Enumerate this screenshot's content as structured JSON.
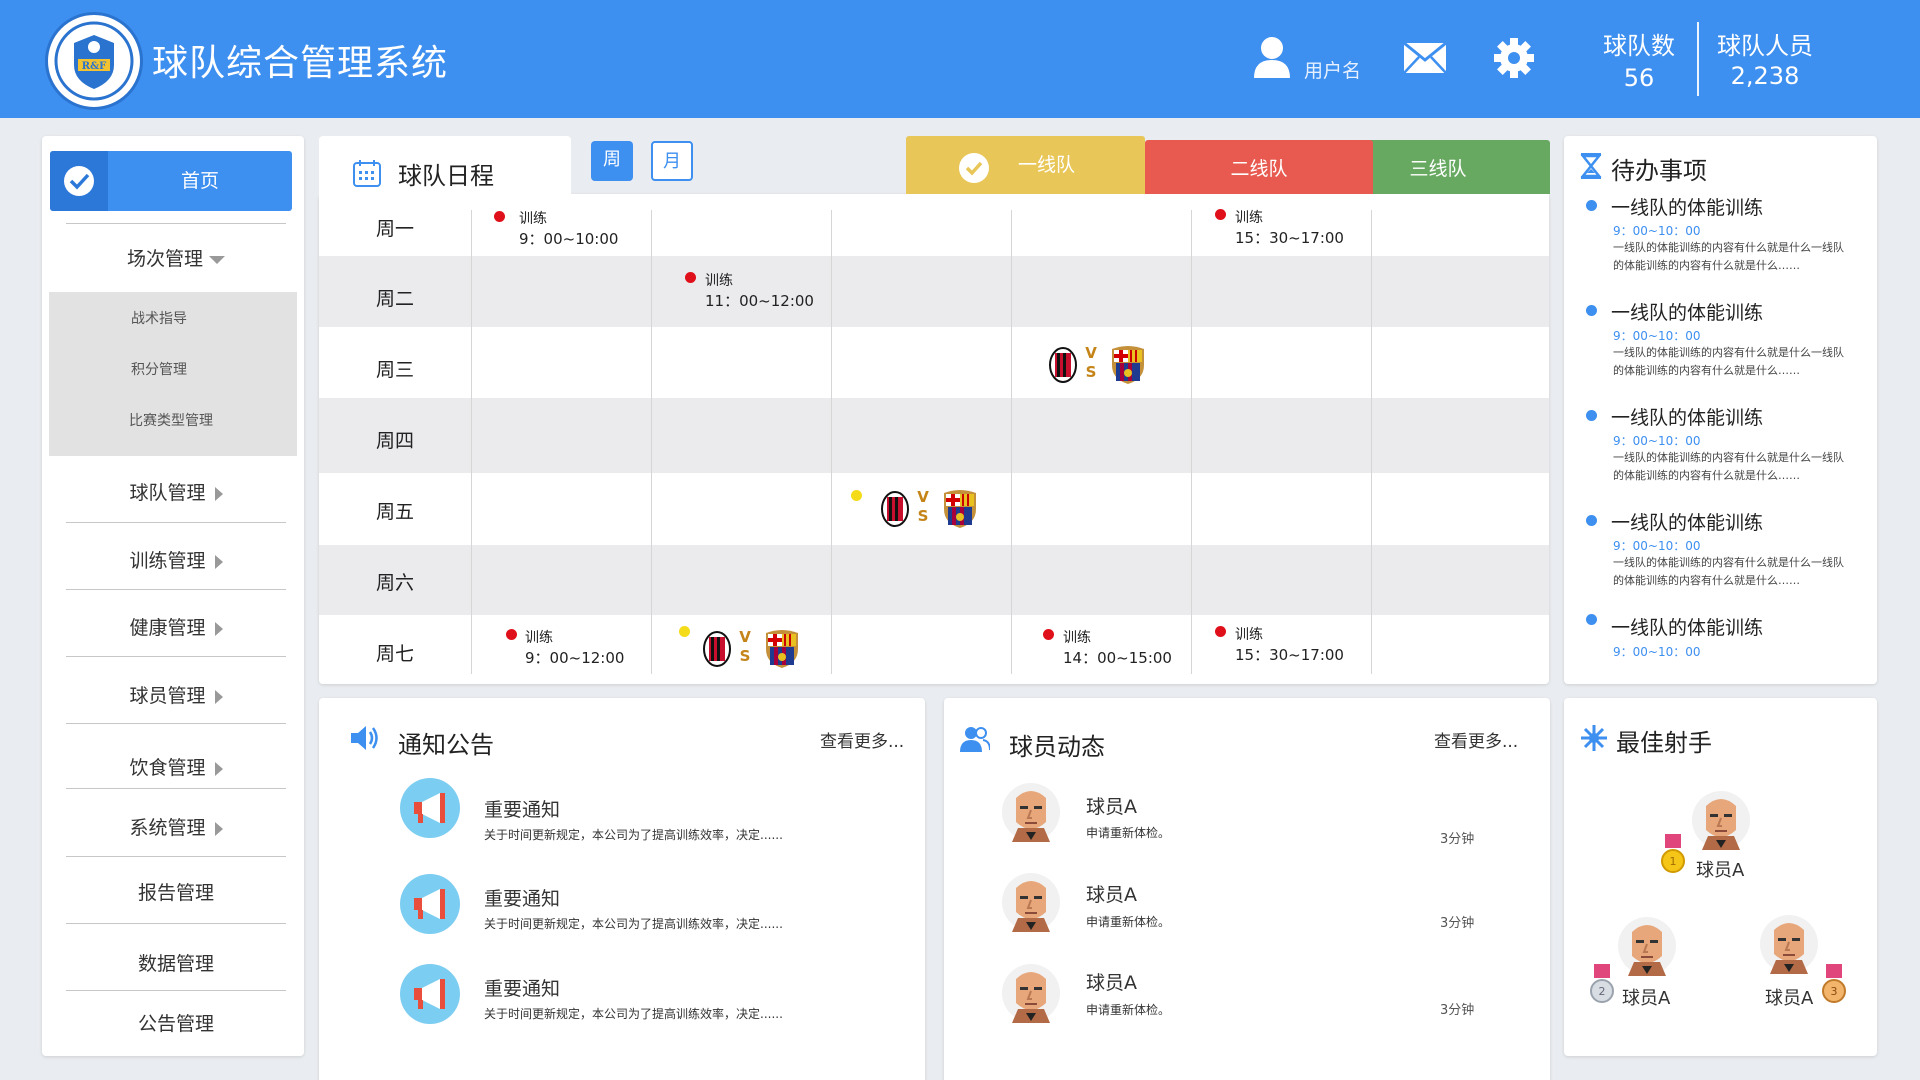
{
  "header": {
    "title": "球队综合管理系统",
    "logo_text": "R&F",
    "username": "用户名",
    "stats": [
      {
        "label": "球队数",
        "value": "56"
      },
      {
        "label": "球队人员",
        "value": "2,238"
      }
    ]
  },
  "sidebar": {
    "home": "首页",
    "match_mgmt": "场次管理",
    "sub_items": [
      "战术指导",
      "积分管理",
      "比赛类型管理"
    ],
    "items": [
      "球队管理",
      "训练管理",
      "健康管理",
      "球员管理",
      "饮食管理",
      "系统管理",
      "报告管理",
      "数据管理",
      "公告管理"
    ]
  },
  "schedule": {
    "title": "球队日程",
    "view_week": "周",
    "view_month": "月",
    "teams": [
      "一线队",
      "二线队",
      "三线队"
    ],
    "days": [
      "周一",
      "周二",
      "周三",
      "周四",
      "周五",
      "周六",
      "周七"
    ],
    "events": [
      {
        "label": "训练",
        "time": "9：00~10:00"
      },
      {
        "label": "训练",
        "time": "15：30~17:00"
      },
      {
        "label": "训练",
        "time": "11：00~12:00"
      },
      {
        "label": "训练",
        "time": "9：00~12:00"
      },
      {
        "label": "训练",
        "time": "14：00~15:00"
      },
      {
        "label": "训练",
        "time": "15：30~17:00"
      }
    ],
    "vs_v": "V",
    "vs_s": "S"
  },
  "todo": {
    "title": "待办事项",
    "items": [
      {
        "title": "一线队的体能训练",
        "time": "9：00~10：00",
        "desc": "一线队的体能训练的内容有什么就是什么一线队的体能训练的内容有什么就是什么……"
      },
      {
        "title": "一线队的体能训练",
        "time": "9：00~10：00",
        "desc": "一线队的体能训练的内容有什么就是什么一线队的体能训练的内容有什么就是什么……"
      },
      {
        "title": "一线队的体能训练",
        "time": "9：00~10：00",
        "desc": "一线队的体能训练的内容有什么就是什么一线队的体能训练的内容有什么就是什么……"
      },
      {
        "title": "一线队的体能训练",
        "time": "9：00~10：00",
        "desc": "一线队的体能训练的内容有什么就是什么一线队的体能训练的内容有什么就是什么……"
      },
      {
        "title": "一线队的体能训练",
        "time": "9：00~10：00"
      }
    ]
  },
  "notices": {
    "title": "通知公告",
    "more": "查看更多...",
    "items": [
      {
        "title": "重要通知",
        "desc": "关于时间更新规定，本公司为了提高训练效率，决定......"
      },
      {
        "title": "重要通知",
        "desc": "关于时间更新规定，本公司为了提高训练效率，决定......"
      },
      {
        "title": "重要通知",
        "desc": "关于时间更新规定，本公司为了提高训练效率，决定......"
      }
    ]
  },
  "players": {
    "title": "球员动态",
    "more": "查看更多...",
    "items": [
      {
        "name": "球员A",
        "desc": "申请重新体检。",
        "time": "3分钟"
      },
      {
        "name": "球员A",
        "desc": "申请重新体检。",
        "time": "3分钟"
      },
      {
        "name": "球员A",
        "desc": "申请重新体检。",
        "time": "3分钟"
      }
    ]
  },
  "scorers": {
    "title": "最佳射手",
    "first": "球员A",
    "second": "球员A",
    "third": "球员A",
    "medal_labels": [
      "1",
      "2",
      "3"
    ]
  },
  "colors": {
    "primary": "#3d8ff0",
    "team1": "#e8c658",
    "team2": "#e85a4f",
    "team3": "#68a962",
    "event_red": "#e0101a",
    "event_yellow": "#f5dc1a"
  }
}
